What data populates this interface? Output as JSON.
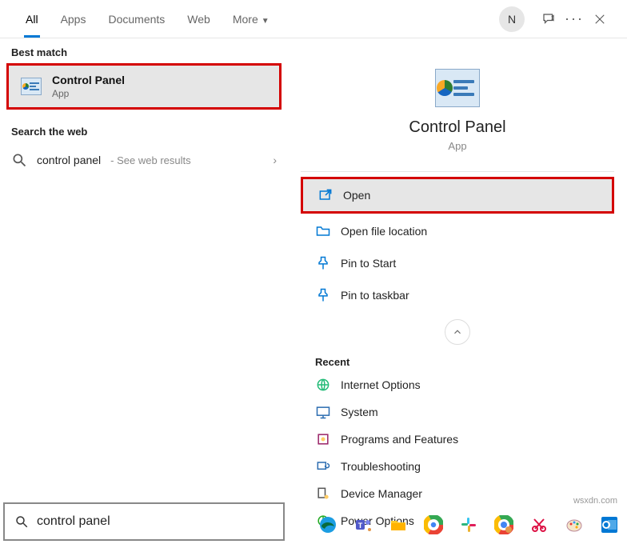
{
  "tabs": {
    "all": "All",
    "apps": "Apps",
    "documents": "Documents",
    "web": "Web",
    "more": "More"
  },
  "header": {
    "avatar_initial": "N"
  },
  "left": {
    "best_match_header": "Best match",
    "best_match": {
      "title": "Control Panel",
      "subtitle": "App"
    },
    "search_web_header": "Search the web",
    "web_query": "control panel",
    "web_hint": " - See web results"
  },
  "right": {
    "title": "Control Panel",
    "subtitle": "App",
    "actions": {
      "open": "Open",
      "open_file_location": "Open file location",
      "pin_to_start": "Pin to Start",
      "pin_to_taskbar": "Pin to taskbar"
    },
    "recent_header": "Recent",
    "recent": [
      "Internet Options",
      "System",
      "Programs and Features",
      "Troubleshooting",
      "Device Manager",
      "Power Options"
    ]
  },
  "search": {
    "value": "control panel"
  },
  "watermark": "wsxdn.com"
}
